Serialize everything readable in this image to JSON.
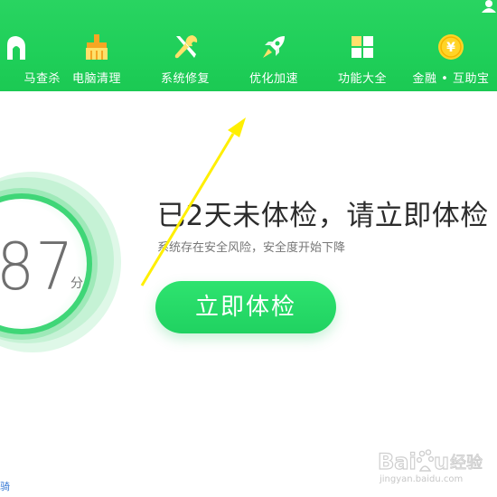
{
  "toolbar": {
    "items": [
      {
        "label": "马查杀",
        "icon": "trojan-scan-icon"
      },
      {
        "label": "电脑清理",
        "icon": "broom-icon"
      },
      {
        "label": "系统修复",
        "icon": "wrench-screwdriver-icon"
      },
      {
        "label": "优化加速",
        "icon": "rocket-icon"
      },
      {
        "label": "功能大全",
        "icon": "grid-icon"
      },
      {
        "label": "金融 • 互助宝",
        "icon": "yuan-coin-icon"
      }
    ],
    "user_icon": "user-icon"
  },
  "score": {
    "value": "87",
    "unit": "分"
  },
  "main": {
    "headline": "已2天未体检，请立即体检",
    "subline": "系统存在安全风险，安全度开始下降",
    "check_button": "立即体检"
  },
  "footer": {
    "corner_text": "骑"
  },
  "watermark": {
    "text": "Baidu经验",
    "sub": "jingyan.baidu.com"
  },
  "colors": {
    "toolbar_green": "#1fcf59",
    "button_green": "#24d865",
    "arrow_yellow": "#ffee00"
  }
}
